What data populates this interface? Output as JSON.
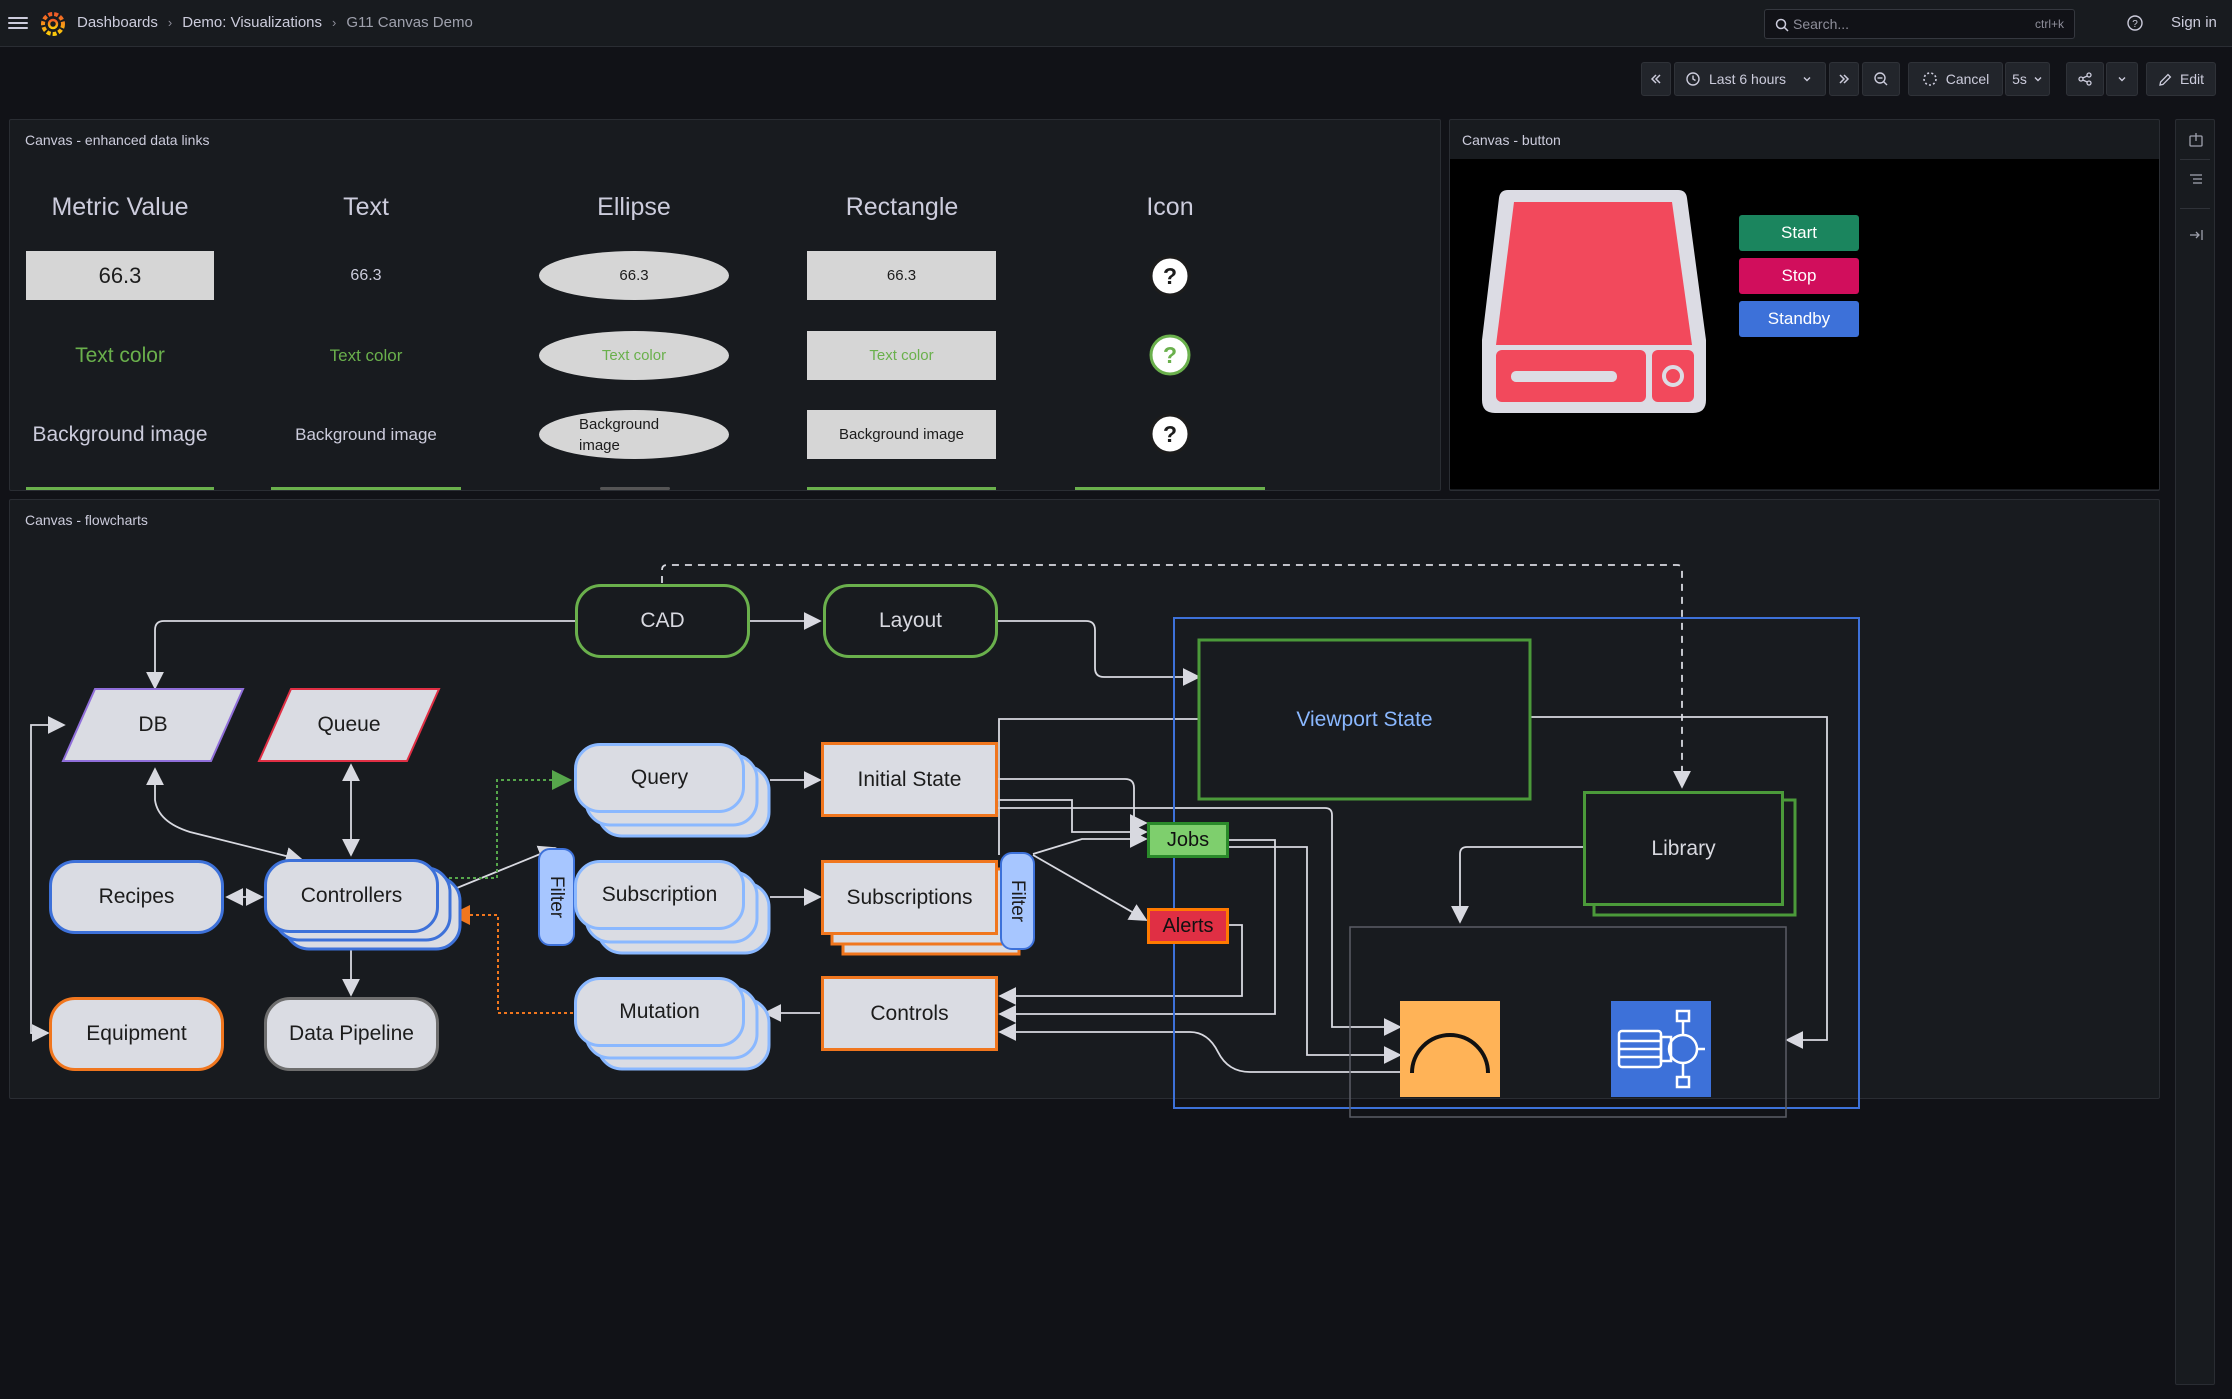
{
  "header": {
    "breadcrumbs": [
      "Dashboards",
      "Demo: Visualizations",
      "G11 Canvas Demo"
    ],
    "search_placeholder": "Search...",
    "search_shortcut": "ctrl+k",
    "sign_in": "Sign in"
  },
  "toolbar": {
    "time_range": "Last 6 hours",
    "cancel": "Cancel",
    "refresh_interval": "5s",
    "edit": "Edit"
  },
  "panel_links": {
    "title": "Canvas - enhanced data links",
    "columns": [
      "Metric Value",
      "Text",
      "Ellipse",
      "Rectangle",
      "Icon"
    ],
    "value": "66.3",
    "text_color": "Text color",
    "background_image": "Background image",
    "text_color_hex": "#6ab04c"
  },
  "panel_button": {
    "title": "Canvas - button",
    "buttons": [
      {
        "label": "Start",
        "color": "#1b855e"
      },
      {
        "label": "Stop",
        "color": "#d10e5c"
      },
      {
        "label": "Standby",
        "color": "#3d71d9"
      }
    ],
    "server_icon": "hard-drive-icon",
    "server_color": "#f2495c"
  },
  "panel_flow": {
    "title": "Canvas - flowcharts",
    "nodes": {
      "cad": "CAD",
      "layout": "Layout",
      "db": "DB",
      "queue": "Queue",
      "query": "Query",
      "initial_state": "Initial State",
      "viewport_state": "Viewport State",
      "recipes": "Recipes",
      "controllers": "Controllers",
      "filter": "Filter",
      "subscription": "Subscription",
      "subscriptions": "Subscriptions",
      "jobs": "Jobs",
      "alerts": "Alerts",
      "library": "Library",
      "equipment": "Equipment",
      "data_pipeline": "Data Pipeline",
      "mutation": "Mutation",
      "controls": "Controls"
    },
    "icons": [
      "gauge-icon",
      "pump-icon"
    ]
  }
}
